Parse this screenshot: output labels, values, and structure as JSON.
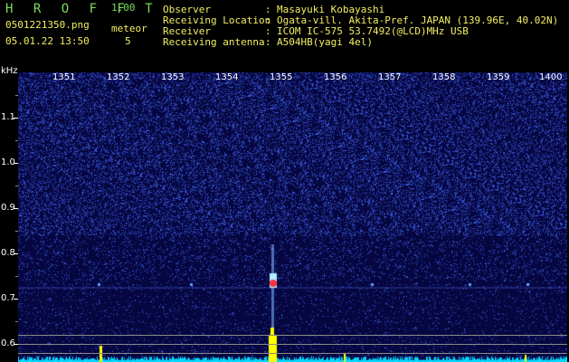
{
  "header": {
    "title": "H R O F F T",
    "version": "1.00",
    "file_name": "0501221350.png",
    "date_time": "05.01.22 13:50",
    "meteor_label": "meteor",
    "meteor_count": "5",
    "fields": [
      {
        "label": "Observer",
        "value": "Masayuki Kobayashi"
      },
      {
        "label": "Receiving Location",
        "value": "Ogata-vill. Akita-Pref. JAPAN (139.96E, 40.02N)"
      },
      {
        "label": "Receiver",
        "value": "ICOM IC-575 53.7492(@LCD)MHz USB"
      },
      {
        "label": "Receiving antenna",
        "value": "A504HB(yagi 4el)"
      }
    ],
    "separator": ":"
  },
  "axis": {
    "unit": "kHz",
    "time_ticks": [
      "1351",
      "1352",
      "1353",
      "1354",
      "1355",
      "1356",
      "1357",
      "1358",
      "1359",
      "1400"
    ],
    "freq_ticks": [
      "1.1",
      "1.0",
      "0.9",
      "0.8",
      "0.7",
      "0.6"
    ]
  },
  "colors": {
    "background": "#060640",
    "noise": "#3a5cff",
    "signal": "#ffff00",
    "spectrum": "#00d8ff",
    "meteor_core": "#ff3040"
  }
}
